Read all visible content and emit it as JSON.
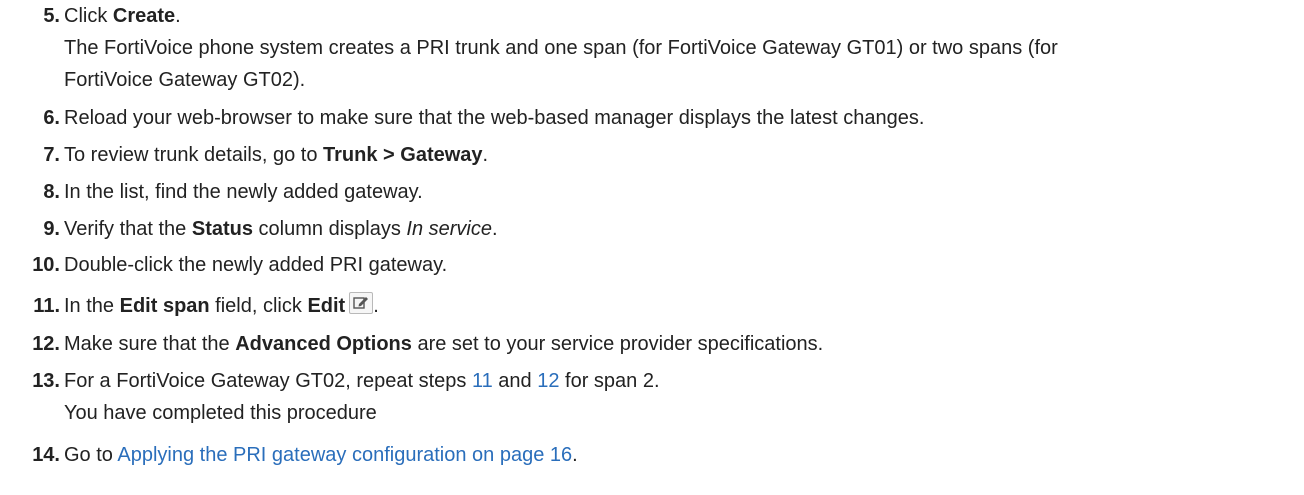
{
  "steps": [
    {
      "number": "5.",
      "parts": {
        "pre": "Click ",
        "bold": "Create",
        "post": "."
      },
      "sub_lines": [
        "The FortiVoice phone system creates a PRI trunk and one span (for FortiVoice Gateway GT01) or two spans (for",
        "FortiVoice Gateway GT02)."
      ]
    },
    {
      "number": "6.",
      "text": "Reload your web-browser to make sure that the web-based manager displays the latest changes."
    },
    {
      "number": "7.",
      "parts": {
        "pre": "To review trunk details, go to ",
        "bold": "Trunk > Gateway",
        "post": "."
      }
    },
    {
      "number": "8.",
      "text": "In the list, find the newly added gateway."
    },
    {
      "number": "9.",
      "parts": {
        "pre": "Verify that the ",
        "bold": "Status",
        "mid": " column displays ",
        "italic": "In service",
        "post": "."
      }
    },
    {
      "number": "10.",
      "text": "Double-click the newly added PRI gateway."
    },
    {
      "number": "11.",
      "parts": {
        "pre": "In the ",
        "bold": "Edit span",
        "mid": " field, click ",
        "bold2": "Edit",
        "post": "."
      },
      "icon": "edit-icon"
    },
    {
      "number": "12.",
      "parts": {
        "pre": "Make sure that the ",
        "bold": "Advanced Options",
        "post": " are set to your service provider specifications."
      }
    },
    {
      "number": "13.",
      "parts": {
        "pre": "For a FortiVoice Gateway GT02, repeat steps ",
        "link1": "11",
        "mid": " and ",
        "link2": "12",
        "post": " for span 2."
      },
      "sub_lines": [
        "You have completed this procedure"
      ]
    },
    {
      "number": "14.",
      "parts": {
        "pre": "Go to ",
        "link": "Applying the PRI gateway configuration on page 16",
        "post": "."
      }
    }
  ],
  "colors": {
    "text": "#222222",
    "link": "#2a6ebb"
  }
}
